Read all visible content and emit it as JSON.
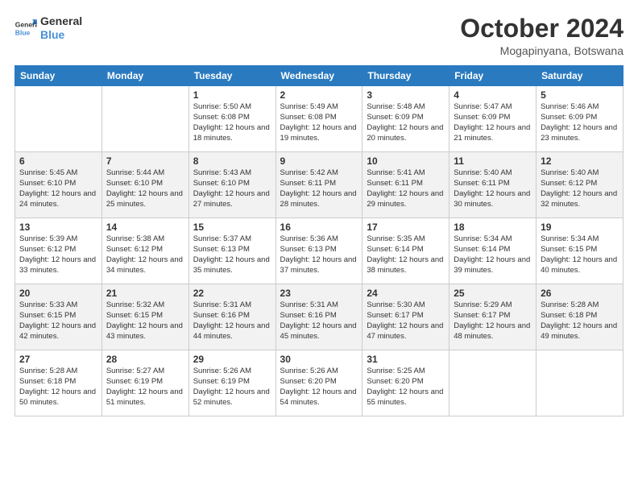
{
  "header": {
    "logo_general": "General",
    "logo_blue": "Blue",
    "month_title": "October 2024",
    "location": "Mogapinyana, Botswana"
  },
  "weekdays": [
    "Sunday",
    "Monday",
    "Tuesday",
    "Wednesday",
    "Thursday",
    "Friday",
    "Saturday"
  ],
  "rows": [
    [
      {
        "day": "",
        "info": ""
      },
      {
        "day": "",
        "info": ""
      },
      {
        "day": "1",
        "info": "Sunrise: 5:50 AM\nSunset: 6:08 PM\nDaylight: 12 hours and 18 minutes."
      },
      {
        "day": "2",
        "info": "Sunrise: 5:49 AM\nSunset: 6:08 PM\nDaylight: 12 hours and 19 minutes."
      },
      {
        "day": "3",
        "info": "Sunrise: 5:48 AM\nSunset: 6:09 PM\nDaylight: 12 hours and 20 minutes."
      },
      {
        "day": "4",
        "info": "Sunrise: 5:47 AM\nSunset: 6:09 PM\nDaylight: 12 hours and 21 minutes."
      },
      {
        "day": "5",
        "info": "Sunrise: 5:46 AM\nSunset: 6:09 PM\nDaylight: 12 hours and 23 minutes."
      }
    ],
    [
      {
        "day": "6",
        "info": "Sunrise: 5:45 AM\nSunset: 6:10 PM\nDaylight: 12 hours and 24 minutes."
      },
      {
        "day": "7",
        "info": "Sunrise: 5:44 AM\nSunset: 6:10 PM\nDaylight: 12 hours and 25 minutes."
      },
      {
        "day": "8",
        "info": "Sunrise: 5:43 AM\nSunset: 6:10 PM\nDaylight: 12 hours and 27 minutes."
      },
      {
        "day": "9",
        "info": "Sunrise: 5:42 AM\nSunset: 6:11 PM\nDaylight: 12 hours and 28 minutes."
      },
      {
        "day": "10",
        "info": "Sunrise: 5:41 AM\nSunset: 6:11 PM\nDaylight: 12 hours and 29 minutes."
      },
      {
        "day": "11",
        "info": "Sunrise: 5:40 AM\nSunset: 6:11 PM\nDaylight: 12 hours and 30 minutes."
      },
      {
        "day": "12",
        "info": "Sunrise: 5:40 AM\nSunset: 6:12 PM\nDaylight: 12 hours and 32 minutes."
      }
    ],
    [
      {
        "day": "13",
        "info": "Sunrise: 5:39 AM\nSunset: 6:12 PM\nDaylight: 12 hours and 33 minutes."
      },
      {
        "day": "14",
        "info": "Sunrise: 5:38 AM\nSunset: 6:12 PM\nDaylight: 12 hours and 34 minutes."
      },
      {
        "day": "15",
        "info": "Sunrise: 5:37 AM\nSunset: 6:13 PM\nDaylight: 12 hours and 35 minutes."
      },
      {
        "day": "16",
        "info": "Sunrise: 5:36 AM\nSunset: 6:13 PM\nDaylight: 12 hours and 37 minutes."
      },
      {
        "day": "17",
        "info": "Sunrise: 5:35 AM\nSunset: 6:14 PM\nDaylight: 12 hours and 38 minutes."
      },
      {
        "day": "18",
        "info": "Sunrise: 5:34 AM\nSunset: 6:14 PM\nDaylight: 12 hours and 39 minutes."
      },
      {
        "day": "19",
        "info": "Sunrise: 5:34 AM\nSunset: 6:15 PM\nDaylight: 12 hours and 40 minutes."
      }
    ],
    [
      {
        "day": "20",
        "info": "Sunrise: 5:33 AM\nSunset: 6:15 PM\nDaylight: 12 hours and 42 minutes."
      },
      {
        "day": "21",
        "info": "Sunrise: 5:32 AM\nSunset: 6:15 PM\nDaylight: 12 hours and 43 minutes."
      },
      {
        "day": "22",
        "info": "Sunrise: 5:31 AM\nSunset: 6:16 PM\nDaylight: 12 hours and 44 minutes."
      },
      {
        "day": "23",
        "info": "Sunrise: 5:31 AM\nSunset: 6:16 PM\nDaylight: 12 hours and 45 minutes."
      },
      {
        "day": "24",
        "info": "Sunrise: 5:30 AM\nSunset: 6:17 PM\nDaylight: 12 hours and 47 minutes."
      },
      {
        "day": "25",
        "info": "Sunrise: 5:29 AM\nSunset: 6:17 PM\nDaylight: 12 hours and 48 minutes."
      },
      {
        "day": "26",
        "info": "Sunrise: 5:28 AM\nSunset: 6:18 PM\nDaylight: 12 hours and 49 minutes."
      }
    ],
    [
      {
        "day": "27",
        "info": "Sunrise: 5:28 AM\nSunset: 6:18 PM\nDaylight: 12 hours and 50 minutes."
      },
      {
        "day": "28",
        "info": "Sunrise: 5:27 AM\nSunset: 6:19 PM\nDaylight: 12 hours and 51 minutes."
      },
      {
        "day": "29",
        "info": "Sunrise: 5:26 AM\nSunset: 6:19 PM\nDaylight: 12 hours and 52 minutes."
      },
      {
        "day": "30",
        "info": "Sunrise: 5:26 AM\nSunset: 6:20 PM\nDaylight: 12 hours and 54 minutes."
      },
      {
        "day": "31",
        "info": "Sunrise: 5:25 AM\nSunset: 6:20 PM\nDaylight: 12 hours and 55 minutes."
      },
      {
        "day": "",
        "info": ""
      },
      {
        "day": "",
        "info": ""
      }
    ]
  ]
}
